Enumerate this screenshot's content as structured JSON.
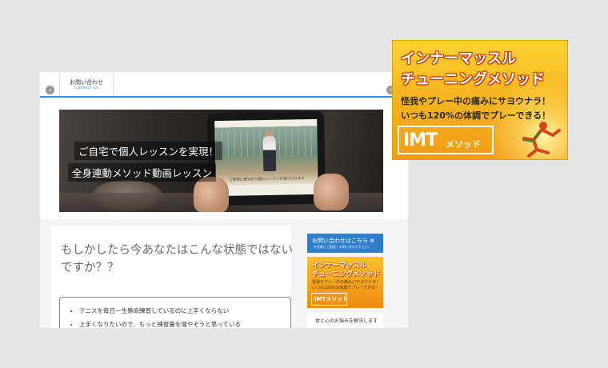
{
  "nav": {
    "contact_jp": "お問い合わせ",
    "contact_en": "Contact us"
  },
  "slider": {
    "line1": "ご自宅で個人レッスンを実現！",
    "line2": "全身連動メソッド動画レッスン",
    "screen_caption": "ご自宅に居ながら個人レッスンを受けられます",
    "dots": 3,
    "active_dot": 1,
    "prev_icon": "chevron-left-icon",
    "next_icon": "chevron-right-icon"
  },
  "main": {
    "headline": "もしかしたら今あなたはこんな状態ではないですか？？",
    "checklist": [
      "テニスを毎日一生懸命練習しているのに上手くならない",
      "上手くなりたいので、もっと練習量を増やそうと思っている"
    ]
  },
  "sidebar": {
    "contact_title": "お問い合わせはこちら ⊕",
    "contact_sub": "お気軽にご相談・お問い合わせ下さい。",
    "banner_line1": "インナーマッスル",
    "banner_line2": "チューニングメソッド",
    "banner_line3": "怪我やプレー中の痛みにサヨウナラ！",
    "banner_line4": "いつも120%の体調でプレーできる！",
    "banner_logo": "IMTメソッド",
    "note": "体と心のお悩みを解決します"
  },
  "banner": {
    "line1": "インナーマッスル",
    "line2": "チューニングメソッド",
    "line3": "怪我やプレー中の痛みにサヨウナラ！",
    "line4": "いつも120%の体調でプレーできる！",
    "logo_main": "IMT",
    "logo_kana": "メソッド"
  },
  "colors": {
    "accent_blue": "#3b8fd6",
    "banner_orange": "#f6b71f",
    "banner_red": "#c83000"
  }
}
